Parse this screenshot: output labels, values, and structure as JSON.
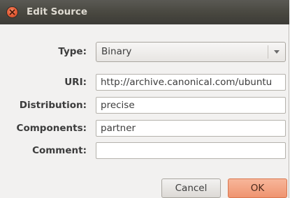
{
  "window": {
    "title": "Edit Source"
  },
  "form": {
    "type_label": "Type:",
    "type_value": "Binary",
    "uri_label": "URI:",
    "uri_value": "http://archive.canonical.com/ubuntu",
    "distribution_label": "Distribution:",
    "distribution_value": "precise",
    "components_label": "Components:",
    "components_value": "partner",
    "comment_label": "Comment:",
    "comment_value": ""
  },
  "buttons": {
    "cancel": "Cancel",
    "ok": "OK"
  },
  "icons": {
    "close": "close-icon",
    "dropdown": "chevron-down-icon"
  },
  "colors": {
    "titlebar": "#3c3b37",
    "close": "#e8613b",
    "ok_button": "#ef9470",
    "background": "#f2f1f0"
  }
}
